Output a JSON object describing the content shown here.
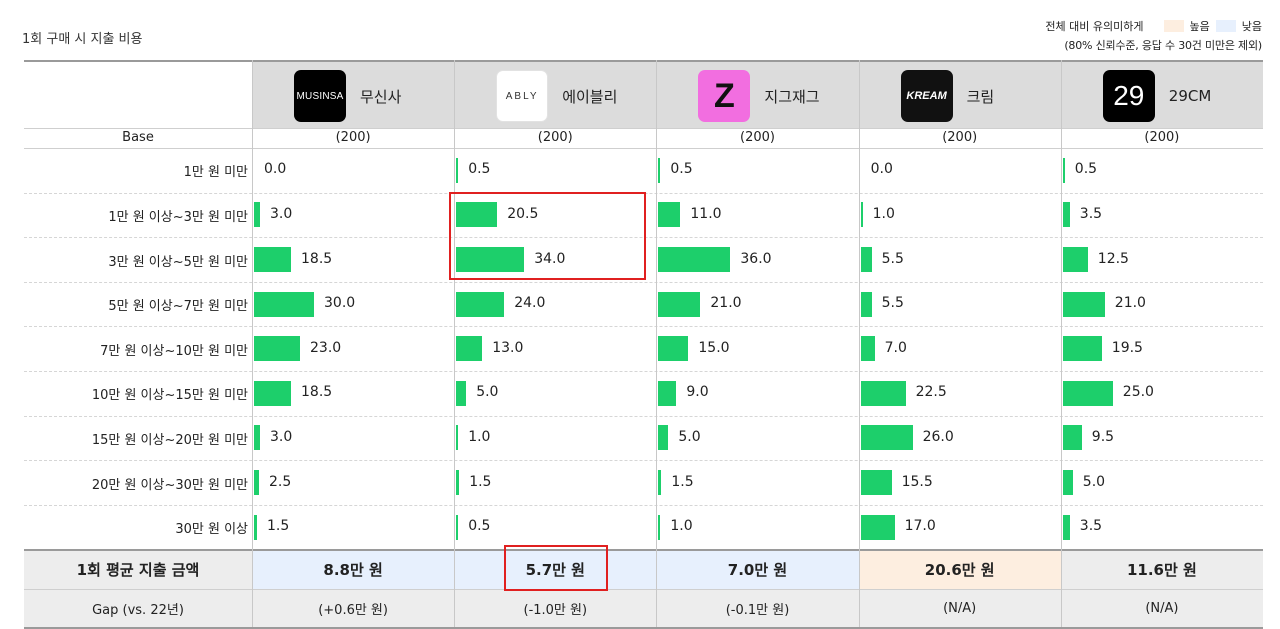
{
  "title": "1회 구매 시 지출 비용",
  "legend": {
    "caption": "전체 대비 유의미하게",
    "high_label": "높음",
    "low_label": "낮음",
    "note": "(80% 신뢰수준, 응답 수 30건 미만은 제외)",
    "high_color": "#fdeee0",
    "low_color": "#e7f0fd"
  },
  "base_label": "Base",
  "avg_label": "1회 평균 지출 금액",
  "gap_label": "Gap (vs. 22년)",
  "brands": [
    {
      "name": "무신사",
      "logo_text": "MUSINSA",
      "logo_icon": "musinsa-logo",
      "base": "(200)",
      "avg": "8.8만 원",
      "gap": "(+0.6만 원)",
      "avg_highlight": "low"
    },
    {
      "name": "에이블리",
      "logo_text": "ABLY",
      "logo_icon": "ably-logo",
      "base": "(200)",
      "avg": "5.7만 원",
      "gap": "(-1.0만 원)",
      "avg_highlight": "low"
    },
    {
      "name": "지그재그",
      "logo_text": "Z",
      "logo_icon": "zigzag-logo",
      "base": "(200)",
      "avg": "7.0만 원",
      "gap": "(-0.1만 원)",
      "avg_highlight": "low"
    },
    {
      "name": "크림",
      "logo_text": "KREAM",
      "logo_icon": "kream-logo",
      "base": "(200)",
      "avg": "20.6만 원",
      "gap": "(N/A)",
      "avg_highlight": "high"
    },
    {
      "name": "29CM",
      "logo_text": "29",
      "logo_icon": "29cm-logo",
      "base": "(200)",
      "avg": "11.6만 원",
      "gap": "(N/A)",
      "avg_highlight": "none"
    }
  ],
  "chart_data": {
    "type": "bar",
    "categories": [
      "1만 원 미만",
      "1만 원 이상~3만 원 미만",
      "3만 원 이상~5만 원 미만",
      "5만 원 이상~7만 원 미만",
      "7만 원 이상~10만 원 미만",
      "10만 원 이상~15만 원 미만",
      "15만 원 이상~20만 원 미만",
      "20만 원 이상~30만 원 미만",
      "30만 원 이상"
    ],
    "series": [
      {
        "name": "무신사",
        "values": [
          0.0,
          3.0,
          18.5,
          30.0,
          23.0,
          18.5,
          3.0,
          2.5,
          1.5
        ]
      },
      {
        "name": "에이블리",
        "values": [
          0.5,
          20.5,
          34.0,
          24.0,
          13.0,
          5.0,
          1.0,
          1.5,
          0.5
        ]
      },
      {
        "name": "지그재그",
        "values": [
          0.5,
          11.0,
          36.0,
          21.0,
          15.0,
          9.0,
          5.0,
          1.5,
          1.0
        ]
      },
      {
        "name": "크림",
        "values": [
          0.0,
          1.0,
          5.5,
          5.5,
          7.0,
          22.5,
          26.0,
          15.5,
          17.0
        ]
      },
      {
        "name": "29CM",
        "values": [
          0.5,
          3.5,
          12.5,
          21.0,
          19.5,
          25.0,
          9.5,
          5.0,
          3.5
        ]
      }
    ],
    "bar_color": "#1dcf6b",
    "value_format": "one-decimal"
  }
}
